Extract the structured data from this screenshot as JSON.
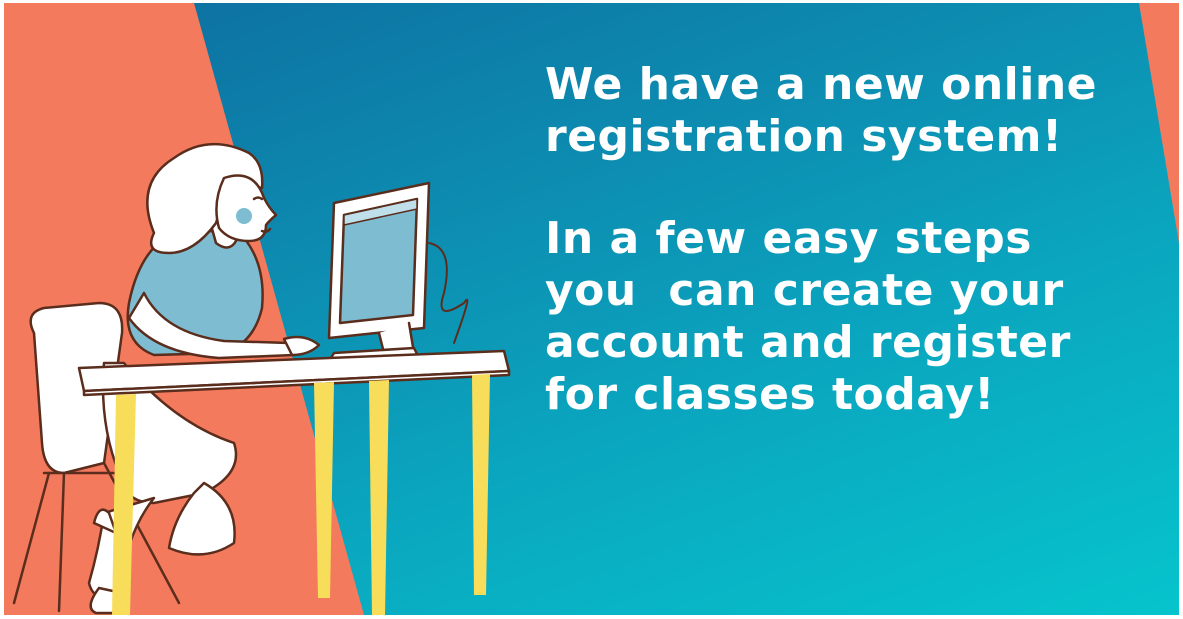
{
  "colors": {
    "coral": "#f47a5e",
    "teal_dark": "#0d6d9f",
    "teal_light": "#06c4cc",
    "skin_outline": "#5a2d1d",
    "shirt": "#7dbcd1",
    "table_legs": "#f7dd5a",
    "white": "#ffffff"
  },
  "icons": [
    "woman-at-computer-illustration"
  ],
  "message": {
    "line1": "We have a new online",
    "line2": "registration system!",
    "line3": "In a few easy steps",
    "line4": "you  can create your",
    "line5": "account and register",
    "line6": "for classes today!"
  }
}
